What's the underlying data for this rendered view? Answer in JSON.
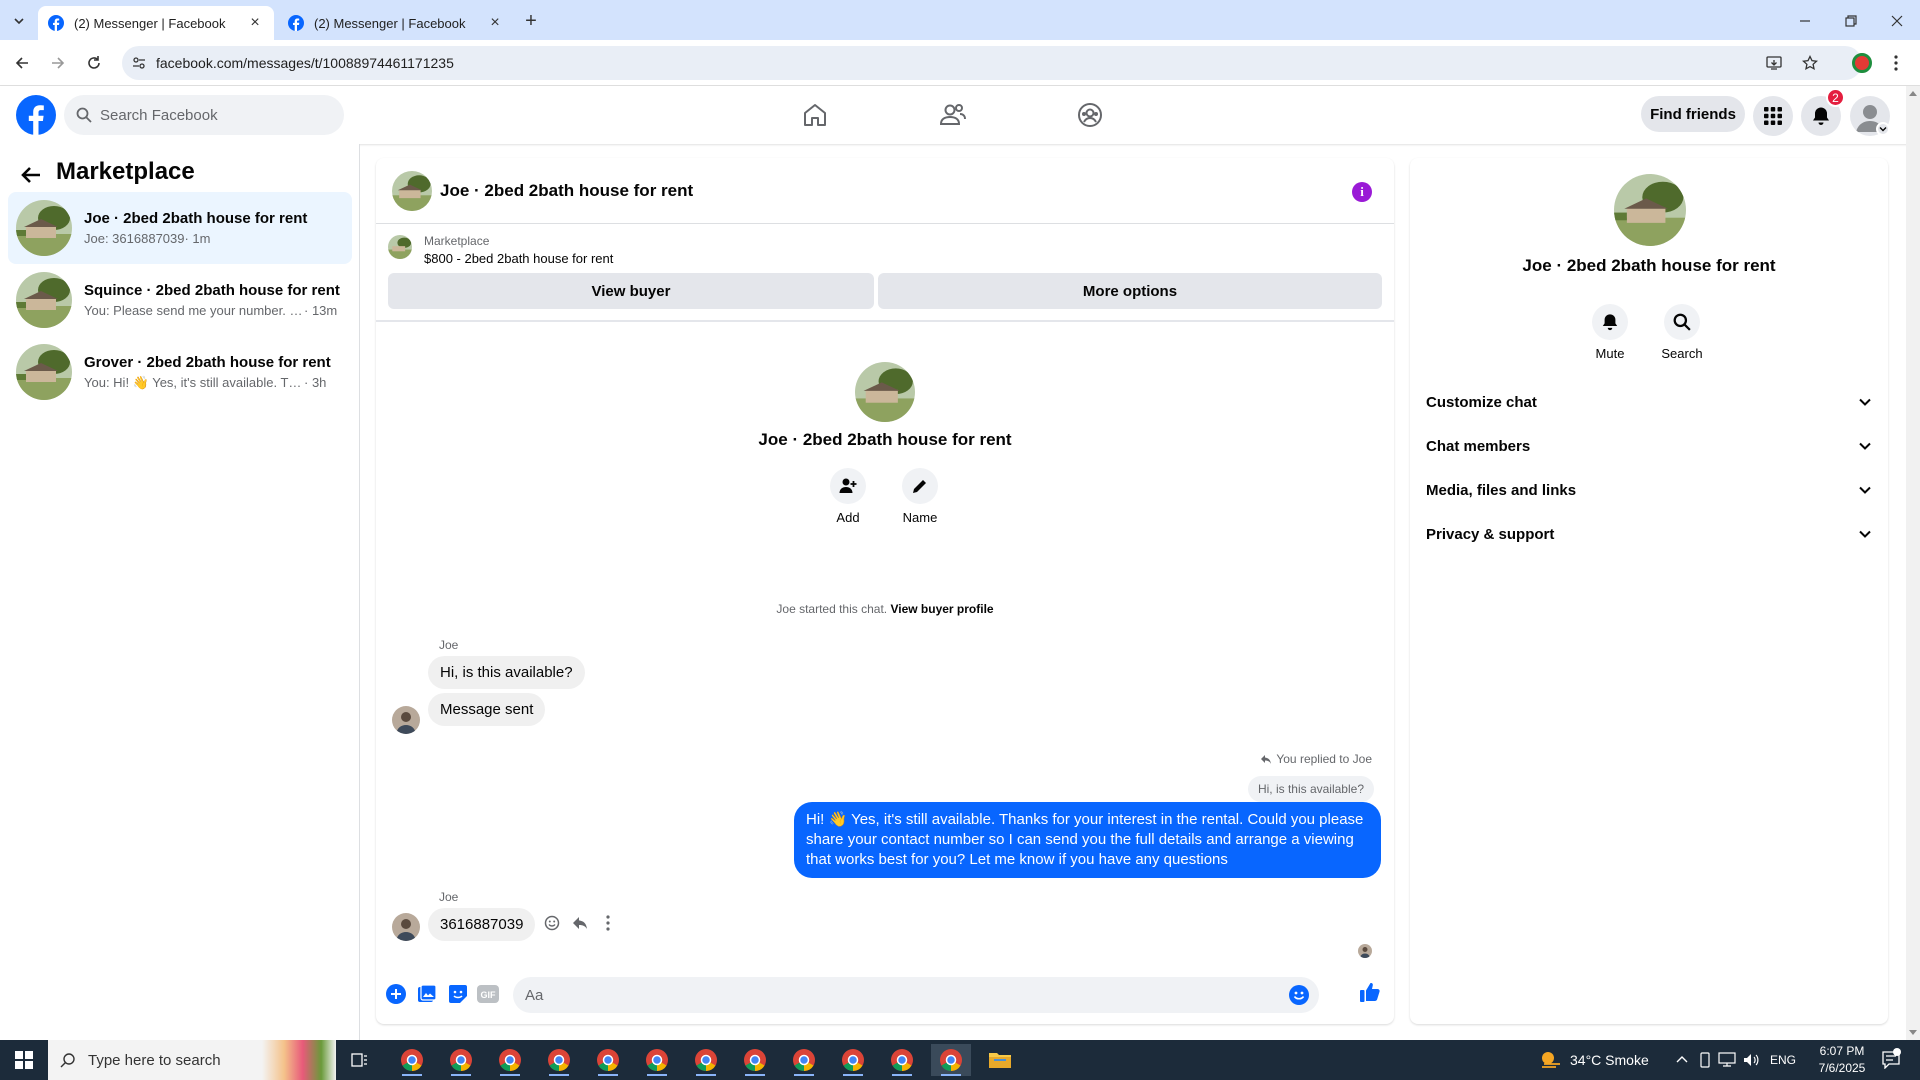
{
  "browser": {
    "tabs": [
      {
        "title": "(2) Messenger | Facebook",
        "active": true
      },
      {
        "title": "(2) Messenger | Facebook",
        "active": false
      }
    ],
    "url": "facebook.com/messages/t/10088974461171235"
  },
  "header": {
    "search_placeholder": "Search Facebook",
    "find_friends": "Find friends",
    "notification_count": "2"
  },
  "sidebar": {
    "title": "Marketplace",
    "conversations": [
      {
        "name": "Joe · 2bed 2bath house for rent",
        "preview": "Joe: 3616887039",
        "time": " · 1m",
        "selected": true
      },
      {
        "name": "Squince · 2bed 2bath house for rent",
        "preview": "You: Please send me your number. I ...",
        "time": " · 13m",
        "selected": false
      },
      {
        "name": "Grover · 2bed 2bath house for rent",
        "preview": "You: Hi! 👋 Yes, it's still available. Tha...",
        "time": " · 3h",
        "selected": false
      }
    ]
  },
  "chat": {
    "title": "Joe · 2bed 2bath house for rent",
    "marketplace_label": "Marketplace",
    "listing": "$800 - 2bed 2bath house for rent",
    "view_buyer": "View buyer",
    "more_options": "More options",
    "profile_name": "Joe · 2bed 2bath house for rent",
    "add_label": "Add",
    "name_label": "Name",
    "started_note": "Joe started this chat. ",
    "view_buyer_profile": "View buyer profile",
    "sender_1": "Joe",
    "msg_1": "Hi, is this available?",
    "msg_2": "Message sent",
    "replied_note": "You replied to Joe",
    "quoted": "Hi, is this available?",
    "outgoing": "Hi! 👋 Yes, it's still available. Thanks for your interest in the rental. Could you please share your contact number so I can send you the full details and arrange a viewing that works best for you? Let me know if you have any questions",
    "sender_2": "Joe",
    "msg_3": "3616887039",
    "composer_placeholder": "Aa"
  },
  "details": {
    "name": "Joe · 2bed 2bath house for rent",
    "mute": "Mute",
    "search": "Search",
    "sections": [
      "Customize chat",
      "Chat members",
      "Media, files and links",
      "Privacy & support"
    ]
  },
  "taskbar": {
    "search_placeholder": "Type here to search",
    "weather": "34°C  Smoke",
    "lang": "ENG",
    "time": "6:07 PM",
    "date": "7/6/2025"
  },
  "colors": {
    "brand": "#0866ff",
    "info": "#9a1ad6",
    "badge": "#e41e3f"
  }
}
